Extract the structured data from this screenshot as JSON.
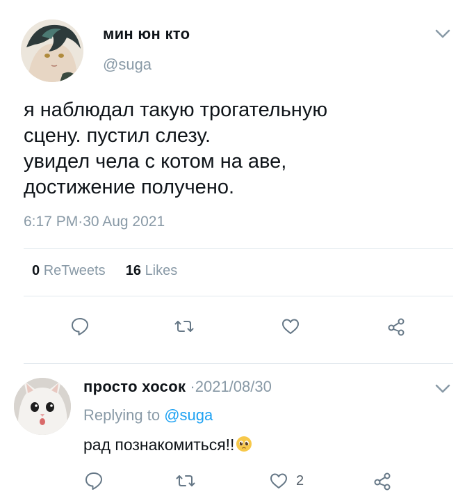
{
  "main_tweet": {
    "author_name": "мин юн кто",
    "handle": "@suga",
    "text_lines": [
      "я наблюдал такую трогательную",
      "сцену. пустил слезу.",
      "увидел чела с котом на аве,",
      "достижение получено."
    ],
    "timestamp": "6:17 PM·30 Aug 2021",
    "retweets_count": "0",
    "retweets_label": "ReTweets",
    "likes_count": "16",
    "likes_label": "Likes"
  },
  "reply": {
    "author_name": "просто хосок",
    "date": "·2021/08/30",
    "replying_label": "Replying to",
    "replying_handle": "@suga",
    "text": "рад познакомиться!!",
    "like_count": "2"
  },
  "icons": {
    "more": "chevron-down-icon",
    "reply": "comment-icon",
    "retweet": "retweet-icon",
    "like": "heart-icon",
    "share": "share-icon",
    "emoji": "pleading-face-emoji"
  },
  "colors": {
    "text": "#0f1419",
    "muted": "#8899a6",
    "mention": "#1da1f2",
    "divider": "#e1e8ed"
  }
}
